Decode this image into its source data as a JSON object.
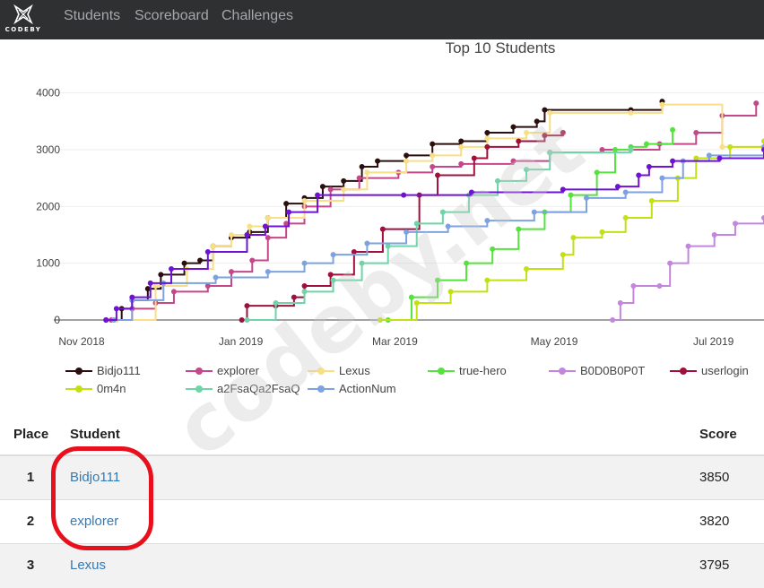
{
  "navbar": {
    "logo_text": "CODEBY",
    "links": [
      "Students",
      "Scoreboard",
      "Challenges"
    ]
  },
  "chart_data": {
    "type": "line",
    "title": "Top 10 Students",
    "xlabel": "",
    "ylabel": "",
    "x_range": [
      "2018-11-01",
      "2019-07-31"
    ],
    "ylim": [
      0,
      4200
    ],
    "x_ticks": [
      "Nov 2018",
      "Jan 2019",
      "Mar 2019",
      "May 2019",
      "Jul 2019"
    ],
    "y_ticks": [
      0,
      1000,
      2000,
      3000,
      4000
    ],
    "legend": "bottom",
    "series": [
      {
        "name": "Bidjo111",
        "color": "#2b0e0e",
        "points": [
          [
            "2018-11-21",
            0
          ],
          [
            "2018-11-27",
            200
          ],
          [
            "2018-12-01",
            350
          ],
          [
            "2018-12-07",
            550
          ],
          [
            "2018-12-12",
            800
          ],
          [
            "2018-12-21",
            1000
          ],
          [
            "2018-12-27",
            1050
          ],
          [
            "2019-01-01",
            1300
          ],
          [
            "2019-01-08",
            1450
          ],
          [
            "2019-01-15",
            1550
          ],
          [
            "2019-01-22",
            1800
          ],
          [
            "2019-01-29",
            2050
          ],
          [
            "2019-02-05",
            2150
          ],
          [
            "2019-02-12",
            2350
          ],
          [
            "2019-02-20",
            2450
          ],
          [
            "2019-02-27",
            2700
          ],
          [
            "2019-03-05",
            2800
          ],
          [
            "2019-03-16",
            2900
          ],
          [
            "2019-03-26",
            3100
          ],
          [
            "2019-04-06",
            3150
          ],
          [
            "2019-04-16",
            3300
          ],
          [
            "2019-04-26",
            3400
          ],
          [
            "2019-05-05",
            3500
          ],
          [
            "2019-05-08",
            3700
          ],
          [
            "2019-06-10",
            3700
          ],
          [
            "2019-06-22",
            3850
          ]
        ]
      },
      {
        "name": "explorer",
        "color": "#c4478a",
        "points": [
          [
            "2018-11-23",
            0
          ],
          [
            "2018-12-01",
            200
          ],
          [
            "2018-12-10",
            300
          ],
          [
            "2018-12-17",
            500
          ],
          [
            "2018-12-30",
            600
          ],
          [
            "2019-01-08",
            850
          ],
          [
            "2019-01-16",
            1050
          ],
          [
            "2019-01-22",
            1450
          ],
          [
            "2019-01-29",
            1700
          ],
          [
            "2019-02-05",
            2000
          ],
          [
            "2019-02-15",
            2300
          ],
          [
            "2019-02-26",
            2500
          ],
          [
            "2019-03-13",
            2600
          ],
          [
            "2019-03-26",
            2700
          ],
          [
            "2019-04-06",
            2750
          ],
          [
            "2019-04-26",
            2800
          ],
          [
            "2019-05-10",
            2950
          ],
          [
            "2019-05-30",
            3000
          ],
          [
            "2019-06-21",
            3100
          ],
          [
            "2019-07-05",
            3300
          ],
          [
            "2019-07-15",
            3600
          ],
          [
            "2019-07-28",
            3820
          ]
        ]
      },
      {
        "name": "Lexus",
        "color": "#f8df86",
        "points": [
          [
            "2018-11-25",
            0
          ],
          [
            "2018-12-10",
            600
          ],
          [
            "2018-12-22",
            900
          ],
          [
            "2019-01-01",
            1300
          ],
          [
            "2019-01-08",
            1500
          ],
          [
            "2019-01-15",
            1650
          ],
          [
            "2019-01-22",
            1800
          ],
          [
            "2019-02-05",
            2100
          ],
          [
            "2019-02-20",
            2300
          ],
          [
            "2019-03-01",
            2600
          ],
          [
            "2019-03-16",
            2800
          ],
          [
            "2019-03-26",
            2900
          ],
          [
            "2019-04-06",
            3050
          ],
          [
            "2019-04-16",
            3200
          ],
          [
            "2019-05-01",
            3300
          ],
          [
            "2019-05-10",
            3650
          ],
          [
            "2019-06-10",
            3650
          ],
          [
            "2019-06-22",
            3795
          ],
          [
            "2019-07-15",
            3050
          ],
          [
            "2019-07-31",
            3150
          ]
        ]
      },
      {
        "name": "true-hero",
        "color": "#56e23e",
        "points": [
          [
            "2019-03-09",
            0
          ],
          [
            "2019-03-18",
            400
          ],
          [
            "2019-03-28",
            700
          ],
          [
            "2019-04-08",
            1000
          ],
          [
            "2019-04-18",
            1250
          ],
          [
            "2019-04-28",
            1600
          ],
          [
            "2019-05-08",
            1900
          ],
          [
            "2019-05-18",
            2200
          ],
          [
            "2019-05-28",
            2600
          ],
          [
            "2019-06-04",
            3000
          ],
          [
            "2019-06-10",
            3050
          ],
          [
            "2019-06-16",
            3100
          ],
          [
            "2019-06-26",
            3350
          ]
        ]
      },
      {
        "name": "B0D0B0P0T",
        "color": "#c386dd",
        "points": [
          [
            "2019-06-03",
            0
          ],
          [
            "2019-06-06",
            300
          ],
          [
            "2019-06-11",
            600
          ],
          [
            "2019-06-21",
            600
          ],
          [
            "2019-06-25",
            1000
          ],
          [
            "2019-07-02",
            1300
          ],
          [
            "2019-07-12",
            1500
          ],
          [
            "2019-07-20",
            1700
          ],
          [
            "2019-07-31",
            1800
          ]
        ]
      },
      {
        "name": "userlogin",
        "color": "#a0103c",
        "points": [
          [
            "2019-01-12",
            0
          ],
          [
            "2019-01-14",
            250
          ],
          [
            "2019-01-25",
            250
          ],
          [
            "2019-02-01",
            400
          ],
          [
            "2019-02-05",
            600
          ],
          [
            "2019-02-15",
            800
          ],
          [
            "2019-02-24",
            1200
          ],
          [
            "2019-03-07",
            1600
          ],
          [
            "2019-03-21",
            2200
          ],
          [
            "2019-03-28",
            2550
          ],
          [
            "2019-04-11",
            2850
          ],
          [
            "2019-04-16",
            3050
          ],
          [
            "2019-04-28",
            3150
          ],
          [
            "2019-05-08",
            3250
          ],
          [
            "2019-05-15",
            3300
          ]
        ]
      },
      {
        "name": "0m4n",
        "color": "#c3e013",
        "points": [
          [
            "2019-03-06",
            0
          ],
          [
            "2019-03-20",
            300
          ],
          [
            "2019-04-02",
            500
          ],
          [
            "2019-04-16",
            700
          ],
          [
            "2019-05-01",
            900
          ],
          [
            "2019-05-15",
            1150
          ],
          [
            "2019-05-19",
            1450
          ],
          [
            "2019-05-30",
            1550
          ],
          [
            "2019-06-08",
            1800
          ],
          [
            "2019-06-18",
            2100
          ],
          [
            "2019-06-28",
            2500
          ],
          [
            "2019-07-05",
            2850
          ],
          [
            "2019-07-18",
            3050
          ],
          [
            "2019-07-31",
            3150
          ]
        ]
      },
      {
        "name": "a2FsaQa2FsaQ",
        "color": "#6fd4a8",
        "points": [
          [
            "2019-01-14",
            0
          ],
          [
            "2019-01-25",
            300
          ],
          [
            "2019-02-05",
            500
          ],
          [
            "2019-02-16",
            700
          ],
          [
            "2019-02-27",
            1000
          ],
          [
            "2019-03-09",
            1300
          ],
          [
            "2019-03-20",
            1700
          ],
          [
            "2019-03-30",
            1900
          ],
          [
            "2019-04-09",
            2200
          ],
          [
            "2019-04-20",
            2450
          ],
          [
            "2019-05-01",
            2650
          ],
          [
            "2019-05-10",
            2950
          ],
          [
            "2019-06-10",
            3000
          ]
        ]
      },
      {
        "name": "ActionNum",
        "color": "#7ea2e0",
        "points": [
          [
            "2018-11-24",
            0
          ],
          [
            "2018-12-01",
            350
          ],
          [
            "2018-12-13",
            650
          ],
          [
            "2019-01-02",
            750
          ],
          [
            "2019-01-22",
            850
          ],
          [
            "2019-02-05",
            1000
          ],
          [
            "2019-02-16",
            1150
          ],
          [
            "2019-03-01",
            1350
          ],
          [
            "2019-03-16",
            1550
          ],
          [
            "2019-04-01",
            1650
          ],
          [
            "2019-04-16",
            1750
          ],
          [
            "2019-05-04",
            1900
          ],
          [
            "2019-05-24",
            2150
          ],
          [
            "2019-06-08",
            2250
          ],
          [
            "2019-06-22",
            2500
          ],
          [
            "2019-06-30",
            2800
          ],
          [
            "2019-07-10",
            2900
          ],
          [
            "2019-07-31",
            3050
          ]
        ]
      },
      {
        "name": "",
        "color": "#7012d6",
        "points": [
          [
            "2018-11-21",
            0
          ],
          [
            "2018-11-25",
            200
          ],
          [
            "2018-12-01",
            400
          ],
          [
            "2018-12-08",
            650
          ],
          [
            "2018-12-16",
            900
          ],
          [
            "2018-12-30",
            1200
          ],
          [
            "2019-01-14",
            1500
          ],
          [
            "2019-01-21",
            1650
          ],
          [
            "2019-01-30",
            1900
          ],
          [
            "2019-02-10",
            2200
          ],
          [
            "2019-03-15",
            2200
          ],
          [
            "2019-04-10",
            2250
          ],
          [
            "2019-05-15",
            2300
          ],
          [
            "2019-06-05",
            2350
          ],
          [
            "2019-06-13",
            2550
          ],
          [
            "2019-06-17",
            2700
          ],
          [
            "2019-06-26",
            2800
          ],
          [
            "2019-07-14",
            2850
          ],
          [
            "2019-07-31",
            3000
          ]
        ]
      }
    ]
  },
  "watermark": "codeby.net",
  "table": {
    "headers": {
      "place": "Place",
      "student": "Student",
      "score": "Score"
    },
    "rows": [
      {
        "place": "1",
        "student": "Bidjo111",
        "score": "3850"
      },
      {
        "place": "2",
        "student": "explorer",
        "score": "3820"
      },
      {
        "place": "3",
        "student": "Lexus",
        "score": "3795"
      }
    ]
  }
}
